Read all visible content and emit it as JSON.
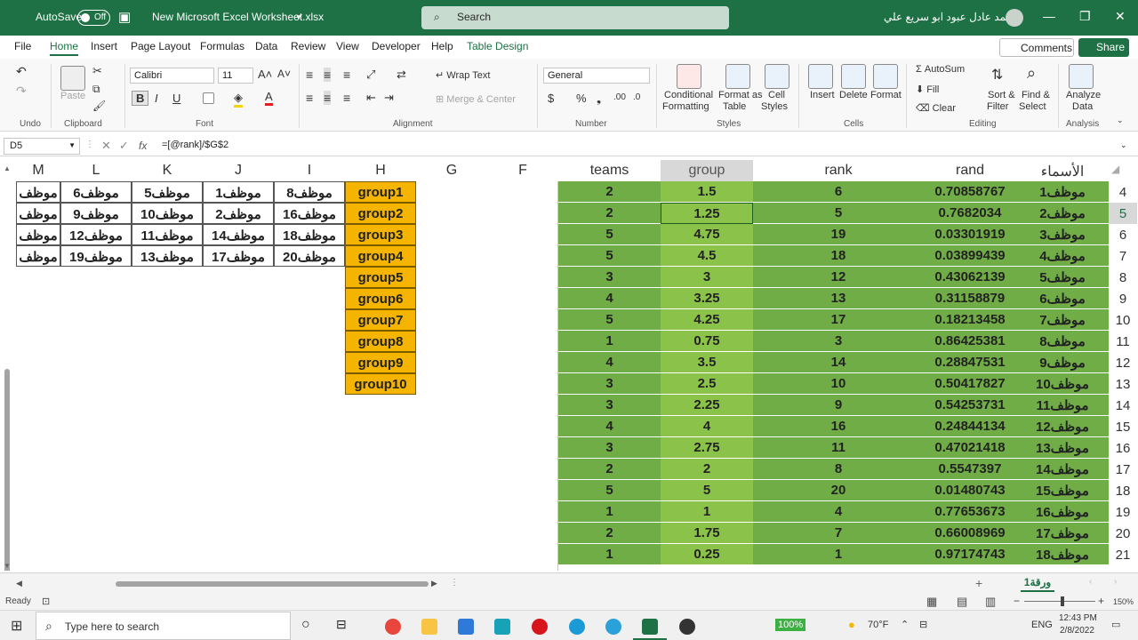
{
  "titlebar": {
    "autosave": "AutoSave",
    "toggle": "Off",
    "filename": "New Microsoft Excel Worksheet.xlsx",
    "search_placeholder": "Search",
    "user": "محمد عادل عبود ابو سريع علي"
  },
  "menu": {
    "file": "File",
    "home": "Home",
    "insert": "Insert",
    "page_layout": "Page Layout",
    "formulas": "Formulas",
    "data": "Data",
    "review": "Review",
    "view": "View",
    "developer": "Developer",
    "help": "Help",
    "table_design": "Table Design",
    "comments": "Comments",
    "share": "Share"
  },
  "ribbon": {
    "undo_label": "Undo",
    "paste": "Paste",
    "clipboard": "Clipboard",
    "font_name": "Calibri",
    "font_size": "11",
    "font": "Font",
    "bold": "B",
    "italic": "I",
    "underline": "U",
    "wrap_text": "Wrap Text",
    "merge_center": "Merge & Center",
    "alignment": "Alignment",
    "number_format": "General",
    "number": "Number",
    "conditional": "Conditional",
    "formatting": "Formatting",
    "format_as": "Format as",
    "table": "Table",
    "cell": "Cell",
    "styles_btn": "Styles",
    "styles": "Styles",
    "insert": "Insert",
    "delete": "Delete",
    "format": "Format",
    "cells": "Cells",
    "autosum": "AutoSum",
    "fill": "Fill",
    "clear": "Clear",
    "sort": "Sort &",
    "filter": "Filter",
    "find": "Find &",
    "select": "Select",
    "editing": "Editing",
    "analyze": "Analyze",
    "data": "Data",
    "analysis": "Analysis"
  },
  "formula_bar": {
    "name_box": "D5",
    "fx": "fx",
    "formula": "=[@rank]/$G$2"
  },
  "columns_left": [
    "M",
    "L",
    "K",
    "J",
    "I",
    "H",
    "G",
    "F"
  ],
  "columns_right": [
    "teams",
    "group",
    "rank",
    "rand",
    "الأسماء"
  ],
  "left_rows": [
    [
      "موظف",
      "موظف6",
      "موظف5",
      "موظف1",
      "موظف8",
      "group1"
    ],
    [
      "موظف",
      "موظف9",
      "موظف10",
      "موظف2",
      "موظف16",
      "group2"
    ],
    [
      "موظف",
      "موظف12",
      "موظف11",
      "موظف14",
      "موظف18",
      "group3"
    ],
    [
      "موظف",
      "موظف19",
      "موظف13",
      "موظف17",
      "موظف20",
      "group4"
    ]
  ],
  "left_groups_extra": [
    "group5",
    "group6",
    "group7",
    "group8",
    "group9",
    "group10"
  ],
  "table_rows": [
    {
      "row": "4",
      "teams": "2",
      "group": "1.5",
      "rank": "6",
      "rand": "0.70858767",
      "name": "موظف1"
    },
    {
      "row": "5",
      "teams": "2",
      "group": "1.25",
      "rank": "5",
      "rand": "0.7682034",
      "name": "موظف2"
    },
    {
      "row": "6",
      "teams": "5",
      "group": "4.75",
      "rank": "19",
      "rand": "0.03301919",
      "name": "موظف3"
    },
    {
      "row": "7",
      "teams": "5",
      "group": "4.5",
      "rank": "18",
      "rand": "0.03899439",
      "name": "موظف4"
    },
    {
      "row": "8",
      "teams": "3",
      "group": "3",
      "rank": "12",
      "rand": "0.43062139",
      "name": "موظف5"
    },
    {
      "row": "9",
      "teams": "4",
      "group": "3.25",
      "rank": "13",
      "rand": "0.31158879",
      "name": "موظف6"
    },
    {
      "row": "10",
      "teams": "5",
      "group": "4.25",
      "rank": "17",
      "rand": "0.18213458",
      "name": "موظف7"
    },
    {
      "row": "11",
      "teams": "1",
      "group": "0.75",
      "rank": "3",
      "rand": "0.86425381",
      "name": "موظف8"
    },
    {
      "row": "12",
      "teams": "4",
      "group": "3.5",
      "rank": "14",
      "rand": "0.28847531",
      "name": "موظف9"
    },
    {
      "row": "13",
      "teams": "3",
      "group": "2.5",
      "rank": "10",
      "rand": "0.50417827",
      "name": "موظف10"
    },
    {
      "row": "14",
      "teams": "3",
      "group": "2.25",
      "rank": "9",
      "rand": "0.54253731",
      "name": "موظف11"
    },
    {
      "row": "15",
      "teams": "4",
      "group": "4",
      "rank": "16",
      "rand": "0.24844134",
      "name": "موظف12"
    },
    {
      "row": "16",
      "teams": "3",
      "group": "2.75",
      "rank": "11",
      "rand": "0.47021418",
      "name": "موظف13"
    },
    {
      "row": "17",
      "teams": "2",
      "group": "2",
      "rank": "8",
      "rand": "0.5547397",
      "name": "موظف14"
    },
    {
      "row": "18",
      "teams": "5",
      "group": "5",
      "rank": "20",
      "rand": "0.01480743",
      "name": "موظف15"
    },
    {
      "row": "19",
      "teams": "1",
      "group": "1",
      "rank": "4",
      "rand": "0.77653673",
      "name": "موظف16"
    },
    {
      "row": "20",
      "teams": "2",
      "group": "1.75",
      "rank": "7",
      "rand": "0.66008969",
      "name": "موظف17"
    },
    {
      "row": "21",
      "teams": "1",
      "group": "0.25",
      "rank": "1",
      "rand": "0.97174743",
      "name": "موظف18"
    }
  ],
  "sheet_tab": "ورقة1",
  "status": {
    "ready": "Ready",
    "zoom": "150%"
  },
  "taskbar": {
    "search": "Type here to search",
    "battery": "100%",
    "weather": "70°F",
    "lang": "ENG",
    "time": "12:43 PM",
    "date": "2/8/2022"
  },
  "colors": {
    "excel_green": "#1e7145",
    "table_green": "#70ad47",
    "group_green": "#8bc34a",
    "group_yellow": "#f4b400"
  }
}
